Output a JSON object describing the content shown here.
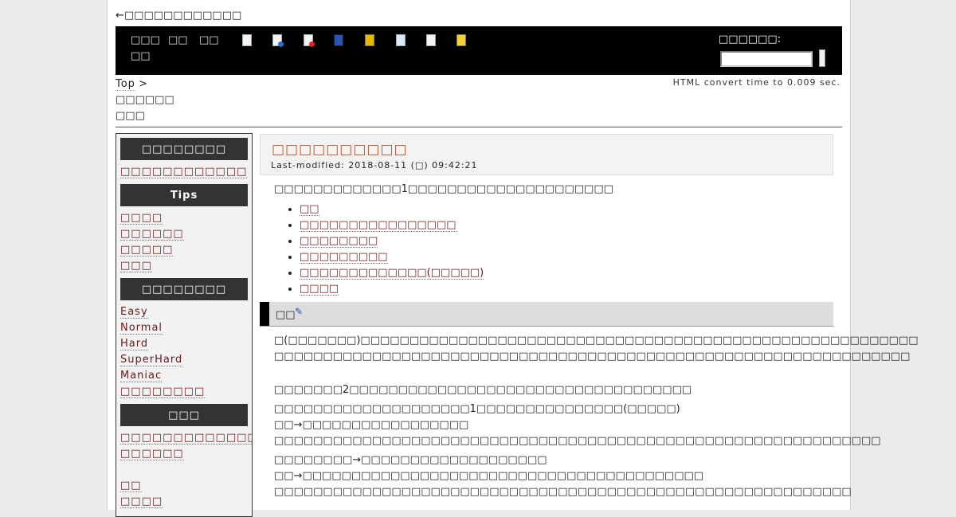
{
  "header": {
    "back_link": "←□□□□□□□□□□□□",
    "menu": [
      "□□□",
      "□□",
      "□□",
      "□□",
      "□□"
    ],
    "search_label": "□□□□□□:",
    "search_value": "",
    "icons": [
      "new-page-icon",
      "edit-page-icon",
      "diff-icon",
      "backup-icon",
      "attach-icon",
      "copy-icon",
      "list-icon",
      "help-icon"
    ]
  },
  "breadcrumb": {
    "top": "Top",
    "sep": " >",
    "line2": "□□□□□□",
    "line3": "□□□"
  },
  "convert_time": "HTML convert time to 0.009 sec.",
  "sidebar": {
    "head1": "□□□□□□□□",
    "link1": "□□□□□□□□□□□□",
    "head2": "Tips",
    "tips": [
      "□□□□",
      "□□□□□□",
      "□□□□□",
      "□□□"
    ],
    "head3": "□□□□□□□□",
    "difficulties": [
      "Easy",
      "Normal",
      "Hard",
      "SuperHard",
      "Maniac",
      "□□□□□□□□"
    ],
    "head4": "□□□",
    "others": [
      "□□□□□□□□□□□□□",
      "□□□□□□",
      "□□",
      "□□□□"
    ]
  },
  "main": {
    "title": "□□□□□□□□□□",
    "modified": "Last-modified: 2018-08-11 (□) 09:42:21",
    "intro": "□□□□□□□□□□□□□1□□□□□□□□□□□□□□□□□□□□□",
    "toc": [
      "□□",
      "□□□□□□□□□□□□□□□□",
      "□□□□□□□□",
      "□□□□□□□□□",
      "□□□□□□□□□□□□□(□□□□□)",
      "□□□□"
    ],
    "section_title": "□□",
    "paragraphs": [
      "□(□□□□□□□)□□□□□□□□□□□□□□□□□□□□□□□□□□□□□□□□□□□□□□□□□□□□□□□□□□□□□□□□□",
      "□□□□□□□□□□□□□□□□□□□□□□□□□□□□□□□□□□□□□□□□□□□□□□□□□□□□□□□□□□□□□□□□□",
      "",
      "□□□□□□□2□□□□□□□□□□□□□□□□□□□□□□□□□□□□□□□□□□□",
      "□□□□□□□□□□□□□□□□□□□□1□□□□□□□□□□□□□□□(□□□□□)",
      "□□→□□□□□□□□□□□□□□□□□",
      "□□□□□□□□□□□□□□□□□□□□□□□□□□□□□□□□□□□□□□□□□□□□□□□□□□□□□□□□□□□□□□",
      "□□□□□□□□→□□□□□□□□□□□□□□□□□□□",
      "□□→□□□□□□□□□□□□□□□□□□□□□□□□□□□□□□□□□□□□□□□□□",
      "□□□□□□□□□□□□□□□□□□□□□□□□□□□□□□□□□□□□□□□□□□□□□□□□□□□□□□□□□□□"
    ]
  },
  "colors": {
    "toolbar_bg": "#000000",
    "title_color": "#c0522e",
    "link_color": "#6a1a1a",
    "side_head_bg": "#333333"
  }
}
